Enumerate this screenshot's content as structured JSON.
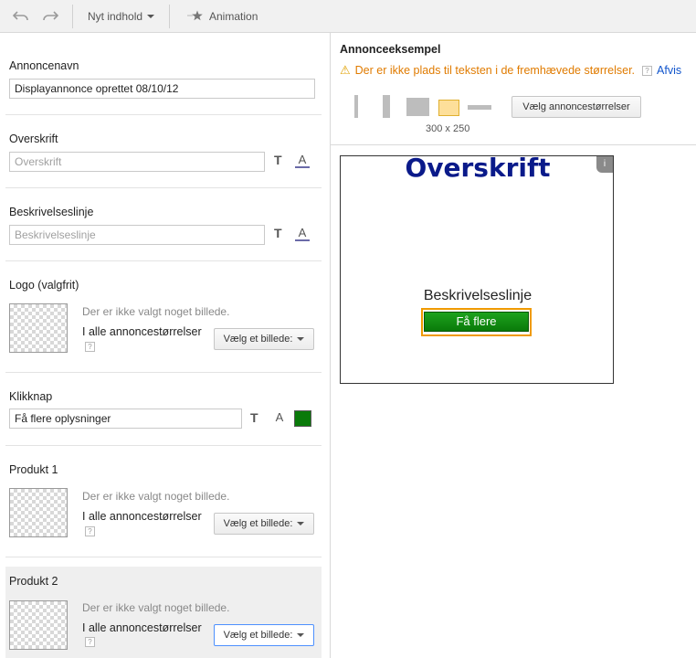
{
  "toolbar": {
    "undo_icon": "undo-icon",
    "redo_icon": "redo-icon",
    "new_content_label": "Nyt indhold",
    "animation_label": "Animation",
    "animation_icon": "star-icon"
  },
  "form": {
    "ad_name": {
      "label": "Annoncenavn",
      "value": "Displayannonce oprettet 08/10/12"
    },
    "headline": {
      "label": "Overskrift",
      "placeholder": "Overskrift"
    },
    "description": {
      "label": "Beskrivelseslinje",
      "placeholder": "Beskrivelseslinje"
    },
    "logo": {
      "label": "Logo  (valgfrit)",
      "no_image": "Der er ikke valgt noget billede.",
      "all_sizes": "I alle annoncestørrelser",
      "choose_image": "Vælg et billede:"
    },
    "click_button": {
      "label": "Klikknap",
      "value": "Få flere oplysninger",
      "color": "#0a7a0a"
    },
    "product1": {
      "label": "Produkt 1",
      "no_image": "Der er ikke valgt noget billede.",
      "all_sizes": "I alle annoncestørrelser",
      "choose_image": "Vælg et billede:"
    },
    "product2": {
      "label": "Produkt 2",
      "no_image": "Der er ikke valgt noget billede.",
      "all_sizes": "I alle annoncestørrelser",
      "choose_image": "Vælg et billede:"
    },
    "help_mark": "?"
  },
  "preview": {
    "title": "Annonceeksempel",
    "warning": "Der er ikke plads til teksten i de fremhævede størrelser.",
    "help_mark": "?",
    "link": "Afvis",
    "choose_sizes": "Vælg annoncestørrelser",
    "selected_size": "300 x 250",
    "ad": {
      "headline": "Overskrift",
      "description": "Beskrivelseslinje",
      "cta": "Få flere",
      "info": "i"
    }
  },
  "colors": {
    "headline": "#0a1a8a",
    "cta": "#0a7a0a",
    "warning": "#e07b00",
    "selected_size": "#fddf9a"
  }
}
